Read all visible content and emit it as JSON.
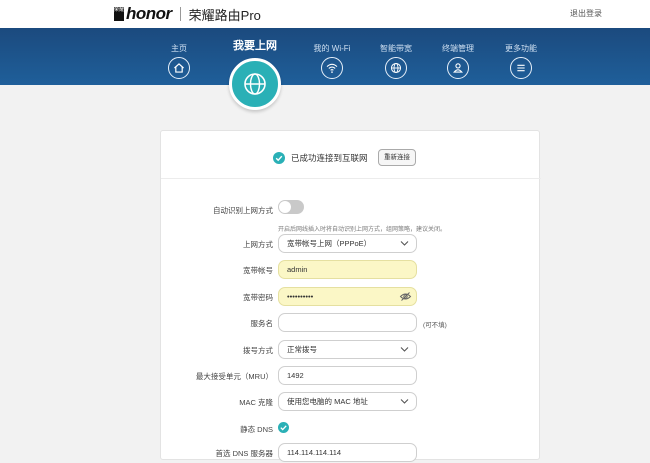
{
  "header": {
    "logo_badge": "荣耀",
    "logo_word": "honor",
    "product": "荣耀路由Pro",
    "logout": "退出登录"
  },
  "nav": {
    "items": [
      {
        "label": "主页",
        "icon": "home-icon"
      },
      {
        "label": "我要上网",
        "icon": "globe-icon",
        "active": true
      },
      {
        "label": "我的 Wi-Fi",
        "icon": "wifi-icon"
      },
      {
        "label": "智能带宽",
        "icon": "bandwidth-globe-icon"
      },
      {
        "label": "终端管理",
        "icon": "user-icon"
      },
      {
        "label": "更多功能",
        "icon": "menu-icon"
      }
    ]
  },
  "status": {
    "text": "已成功连接到互联网",
    "reconnect": "重新连接"
  },
  "form": {
    "auto_detect_label": "自动识别上网方式",
    "auto_detect_on": false,
    "hint": "开启后网线插入时将自动识别上网方式，组网策略，建议关闭。",
    "wan_label": "上网方式",
    "wan_value": "宽带帐号上网（PPPoE）",
    "account_label": "宽带帐号",
    "account_value": "admin",
    "password_label": "宽带密码",
    "password_value": "••••••••••",
    "service_label": "服务名",
    "service_value": "",
    "service_optional": "(可不填)",
    "dial_label": "拨号方式",
    "dial_value": "正常拨号",
    "mru_label": "最大接受单元（MRU）",
    "mru_value": "1492",
    "mac_label": "MAC 克隆",
    "mac_value": "使用您电脑的 MAC 地址",
    "dns_label": "静态 DNS",
    "dns_on": true,
    "primary_dns_label": "首选 DNS 服务器",
    "primary_dns_value": "114.114.114.114"
  },
  "colors": {
    "nav_bg": "#1f5f9a",
    "accent": "#2ab0b6",
    "autofill": "#fbf7c6"
  }
}
